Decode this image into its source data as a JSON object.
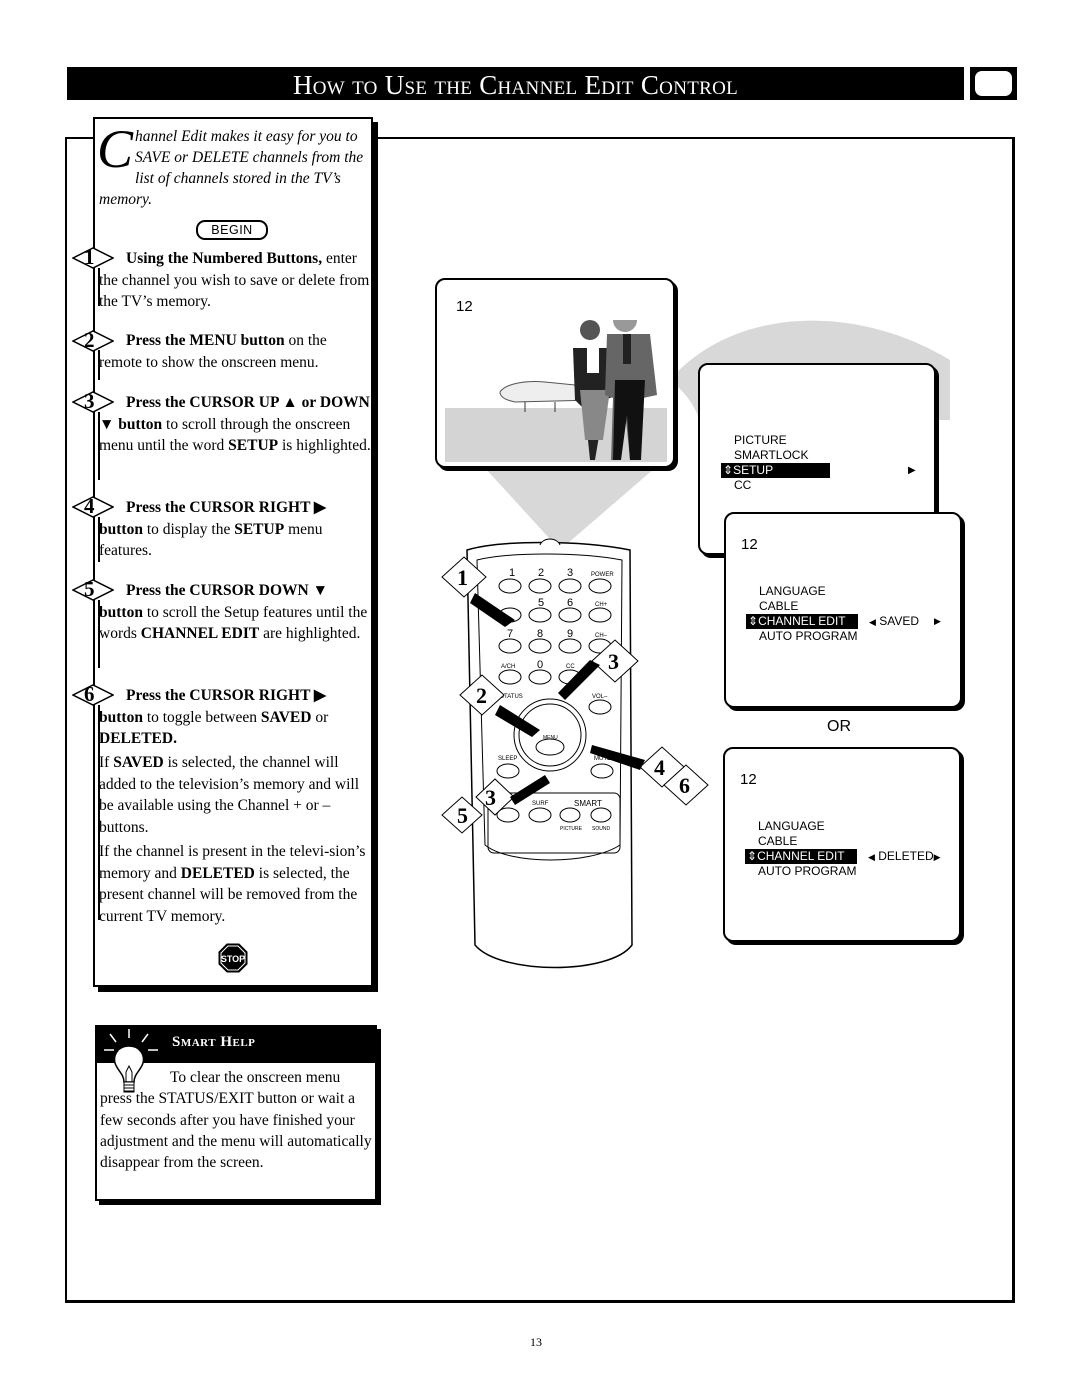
{
  "header": {
    "title": "How to Use the Channel Edit Control",
    "icon": "tv-screen-icon"
  },
  "intro": {
    "dropcap": "C",
    "text": "hannel Edit makes it easy for you to SAVE or DELETE channels from the list of channels stored in the TV’s memory.",
    "begin_label": "BEGIN"
  },
  "steps": [
    {
      "number": "1",
      "bold": "Using the Numbered Buttons,",
      "text": " enter the channel you wish to save or delete from the TV’s memory."
    },
    {
      "number": "2",
      "bold": "Press the MENU button",
      "text": " on the remote to show the onscreen menu."
    },
    {
      "number": "3",
      "bold": "Press the CURSOR UP ▲ or DOWN ▼ button",
      "text": " to scroll through the onscreen menu until the word ",
      "bold2": "SETUP",
      "text2": " is highlighted."
    },
    {
      "number": "4",
      "bold": "Press the CURSOR RIGHT ▶ button",
      "text": " to display the ",
      "bold2": "SETUP",
      "text2": " menu features."
    },
    {
      "number": "5",
      "bold": "Press the CURSOR DOWN ▼ button",
      "text": " to scroll the Setup features until the words ",
      "bold2": "CHANNEL EDIT",
      "text2": " are highlighted."
    },
    {
      "number": "6",
      "bold": "Press the CURSOR RIGHT ▶ button",
      "text": " to toggle between ",
      "bold2": "SAVED",
      "text2": " or ",
      "bold3": "DELETED."
    }
  ],
  "notes": {
    "saved": {
      "pre": "If ",
      "bold": "SAVED",
      "post": " is selected, the channel will added to the television’s memory and will be available using the Channel + or – buttons."
    },
    "deleted": {
      "pre": "If the channel is present in the televi-sion’s memory and ",
      "bold": "DELETED",
      "post": " is selected, the present channel will be removed from the current TV memory."
    },
    "stop_label": "STOP"
  },
  "smart_help": {
    "title": "Smart Help",
    "text": "To clear the onscreen menu press the STATUS/EXIT button or wait a few seconds after you have finished your adjustment and the menu will automatically disappear from the screen."
  },
  "tv_picture": {
    "channel": "12"
  },
  "main_menu": {
    "items": [
      "PICTURE",
      "SMARTLOCK",
      "SETUP",
      "CC"
    ],
    "highlighted": "SETUP"
  },
  "setup_menu_saved": {
    "channel": "12",
    "items": [
      "LANGUAGE",
      "CABLE",
      "CHANNEL EDIT",
      "AUTO PROGRAM"
    ],
    "highlighted": "CHANNEL EDIT",
    "value": "SAVED"
  },
  "or_label": "OR",
  "setup_menu_deleted": {
    "channel": "12",
    "items": [
      "LANGUAGE",
      "CABLE",
      "CHANNEL EDIT",
      "AUTO PROGRAM"
    ],
    "highlighted": "CHANNEL EDIT",
    "value": "DELETED"
  },
  "remote": {
    "buttons": [
      "1",
      "2",
      "3",
      "POWER",
      "5",
      "6",
      "CH+",
      "7",
      "8",
      "9",
      "CH–",
      "A/CH",
      "0",
      "CC",
      "STATUS",
      "VOL–",
      "MENU",
      "SLEEP",
      "MUTE",
      "SURF",
      "SMART",
      "PICTURE",
      "SOUND"
    ],
    "step_tags": [
      "1",
      "2",
      "3",
      "3",
      "4",
      "5",
      "6"
    ]
  },
  "page_number": "13"
}
